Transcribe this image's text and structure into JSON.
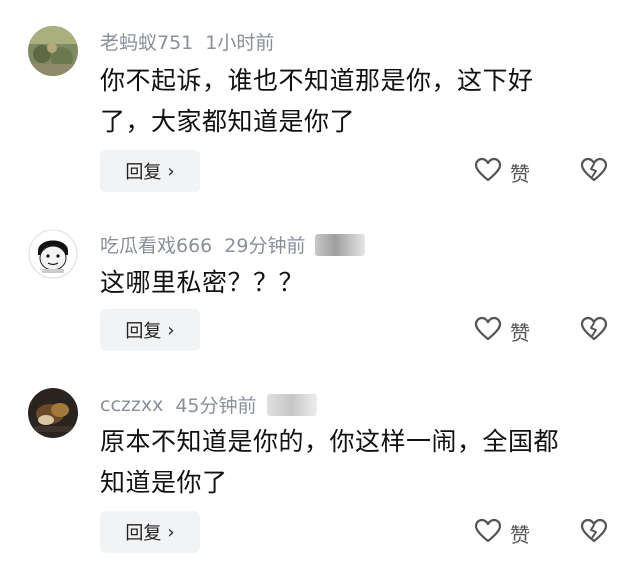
{
  "comments": [
    {
      "username": "老蚂蚁751",
      "time": "1小时前",
      "text_lines": [
        "你不起诉，谁也不知道那是你，这下好",
        "了，大家都知道是你了"
      ],
      "reply_label": "回复",
      "like_label": "赞"
    },
    {
      "username": "吃瓜看戏666",
      "time": "29分钟前",
      "text_lines": [
        "这哪里私密？？？"
      ],
      "reply_label": "回复",
      "like_label": "赞"
    },
    {
      "username": "cczzxx",
      "time": "45分钟前",
      "text_lines": [
        "原本不知道是你的，你这样一闹，全国都",
        "知道是你了"
      ],
      "reply_label": "回复",
      "like_label": "赞"
    }
  ],
  "icons": {
    "like": "heart-outline-icon",
    "dislike": "broken-heart-icon",
    "reply_arrow": "chevron-right-icon"
  },
  "colors": {
    "meta_text": "#8a8f99",
    "reply_bg": "#f2f3f5",
    "icon_stroke": "#555555"
  }
}
